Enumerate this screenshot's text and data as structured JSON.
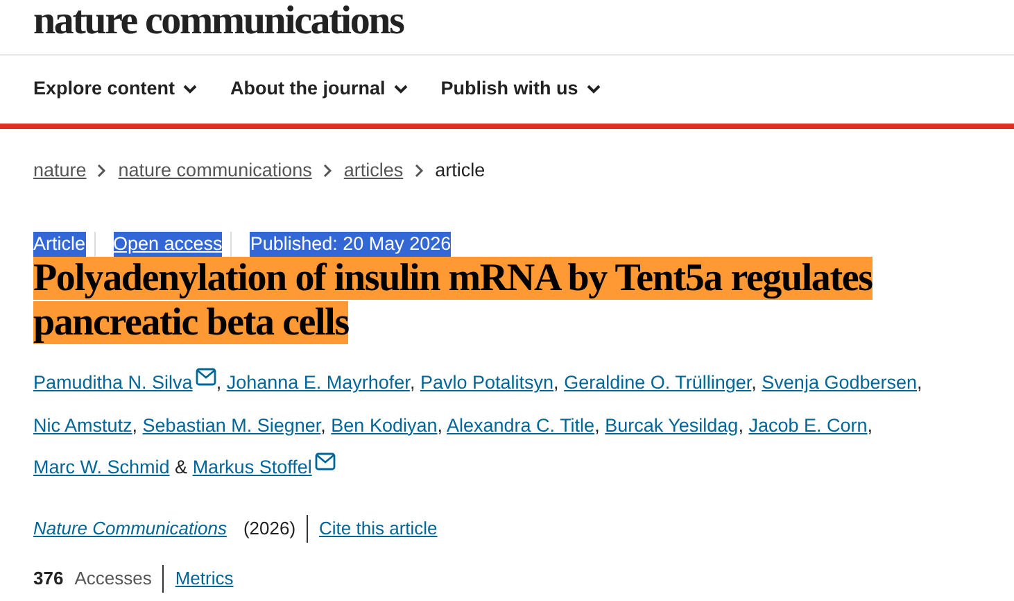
{
  "logo": "nature communications",
  "nav": [
    {
      "label": "Explore content"
    },
    {
      "label": "About the journal"
    },
    {
      "label": "Publish with us"
    }
  ],
  "breadcrumb": [
    {
      "label": "nature",
      "link": true
    },
    {
      "label": "nature communications",
      "link": true
    },
    {
      "label": "articles",
      "link": true
    },
    {
      "label": "article",
      "link": false
    }
  ],
  "meta": [
    {
      "label": "Article",
      "link": false,
      "selected": true
    },
    {
      "label": "Open access",
      "link": true,
      "selected": true
    },
    {
      "label": "Published: 20 May 2026",
      "link": false,
      "selected": true
    }
  ],
  "title": {
    "text": "Polyadenylation of insulin mRNA by Tent5a regulates pancreatic beta cells",
    "highlighted": true
  },
  "authors": [
    {
      "name": "Pamuditha N. Silva",
      "email": true,
      "separator": ","
    },
    {
      "name": "Johanna E. Mayrhofer",
      "email": false,
      "separator": ","
    },
    {
      "name": "Pavlo Potalitsyn",
      "email": false,
      "separator": ","
    },
    {
      "name": "Geraldine O. Trüllinger",
      "email": false,
      "separator": ","
    },
    {
      "name": "Svenja Godbersen",
      "email": false,
      "separator": ","
    },
    {
      "name": "Nic Amstutz",
      "email": false,
      "separator": ","
    },
    {
      "name": "Sebastian M. Siegner",
      "email": false,
      "separator": ","
    },
    {
      "name": "Ben Kodiyan",
      "email": false,
      "separator": ","
    },
    {
      "name": "Alexandra C. Title",
      "email": false,
      "separator": ","
    },
    {
      "name": "Burcak Yesildag",
      "email": false,
      "separator": ","
    },
    {
      "name": "Jacob E. Corn",
      "email": false,
      "separator": ","
    },
    {
      "name": "Marc W. Schmid",
      "email": false,
      "separator": "&"
    },
    {
      "name": "Markus Stoffel",
      "email": true
    }
  ],
  "citation": {
    "journal": "Nature Communications",
    "year": "(2026)",
    "cite_link": "Cite this article"
  },
  "metrics": {
    "count": "376",
    "label": "Accesses",
    "link": "Metrics"
  }
}
